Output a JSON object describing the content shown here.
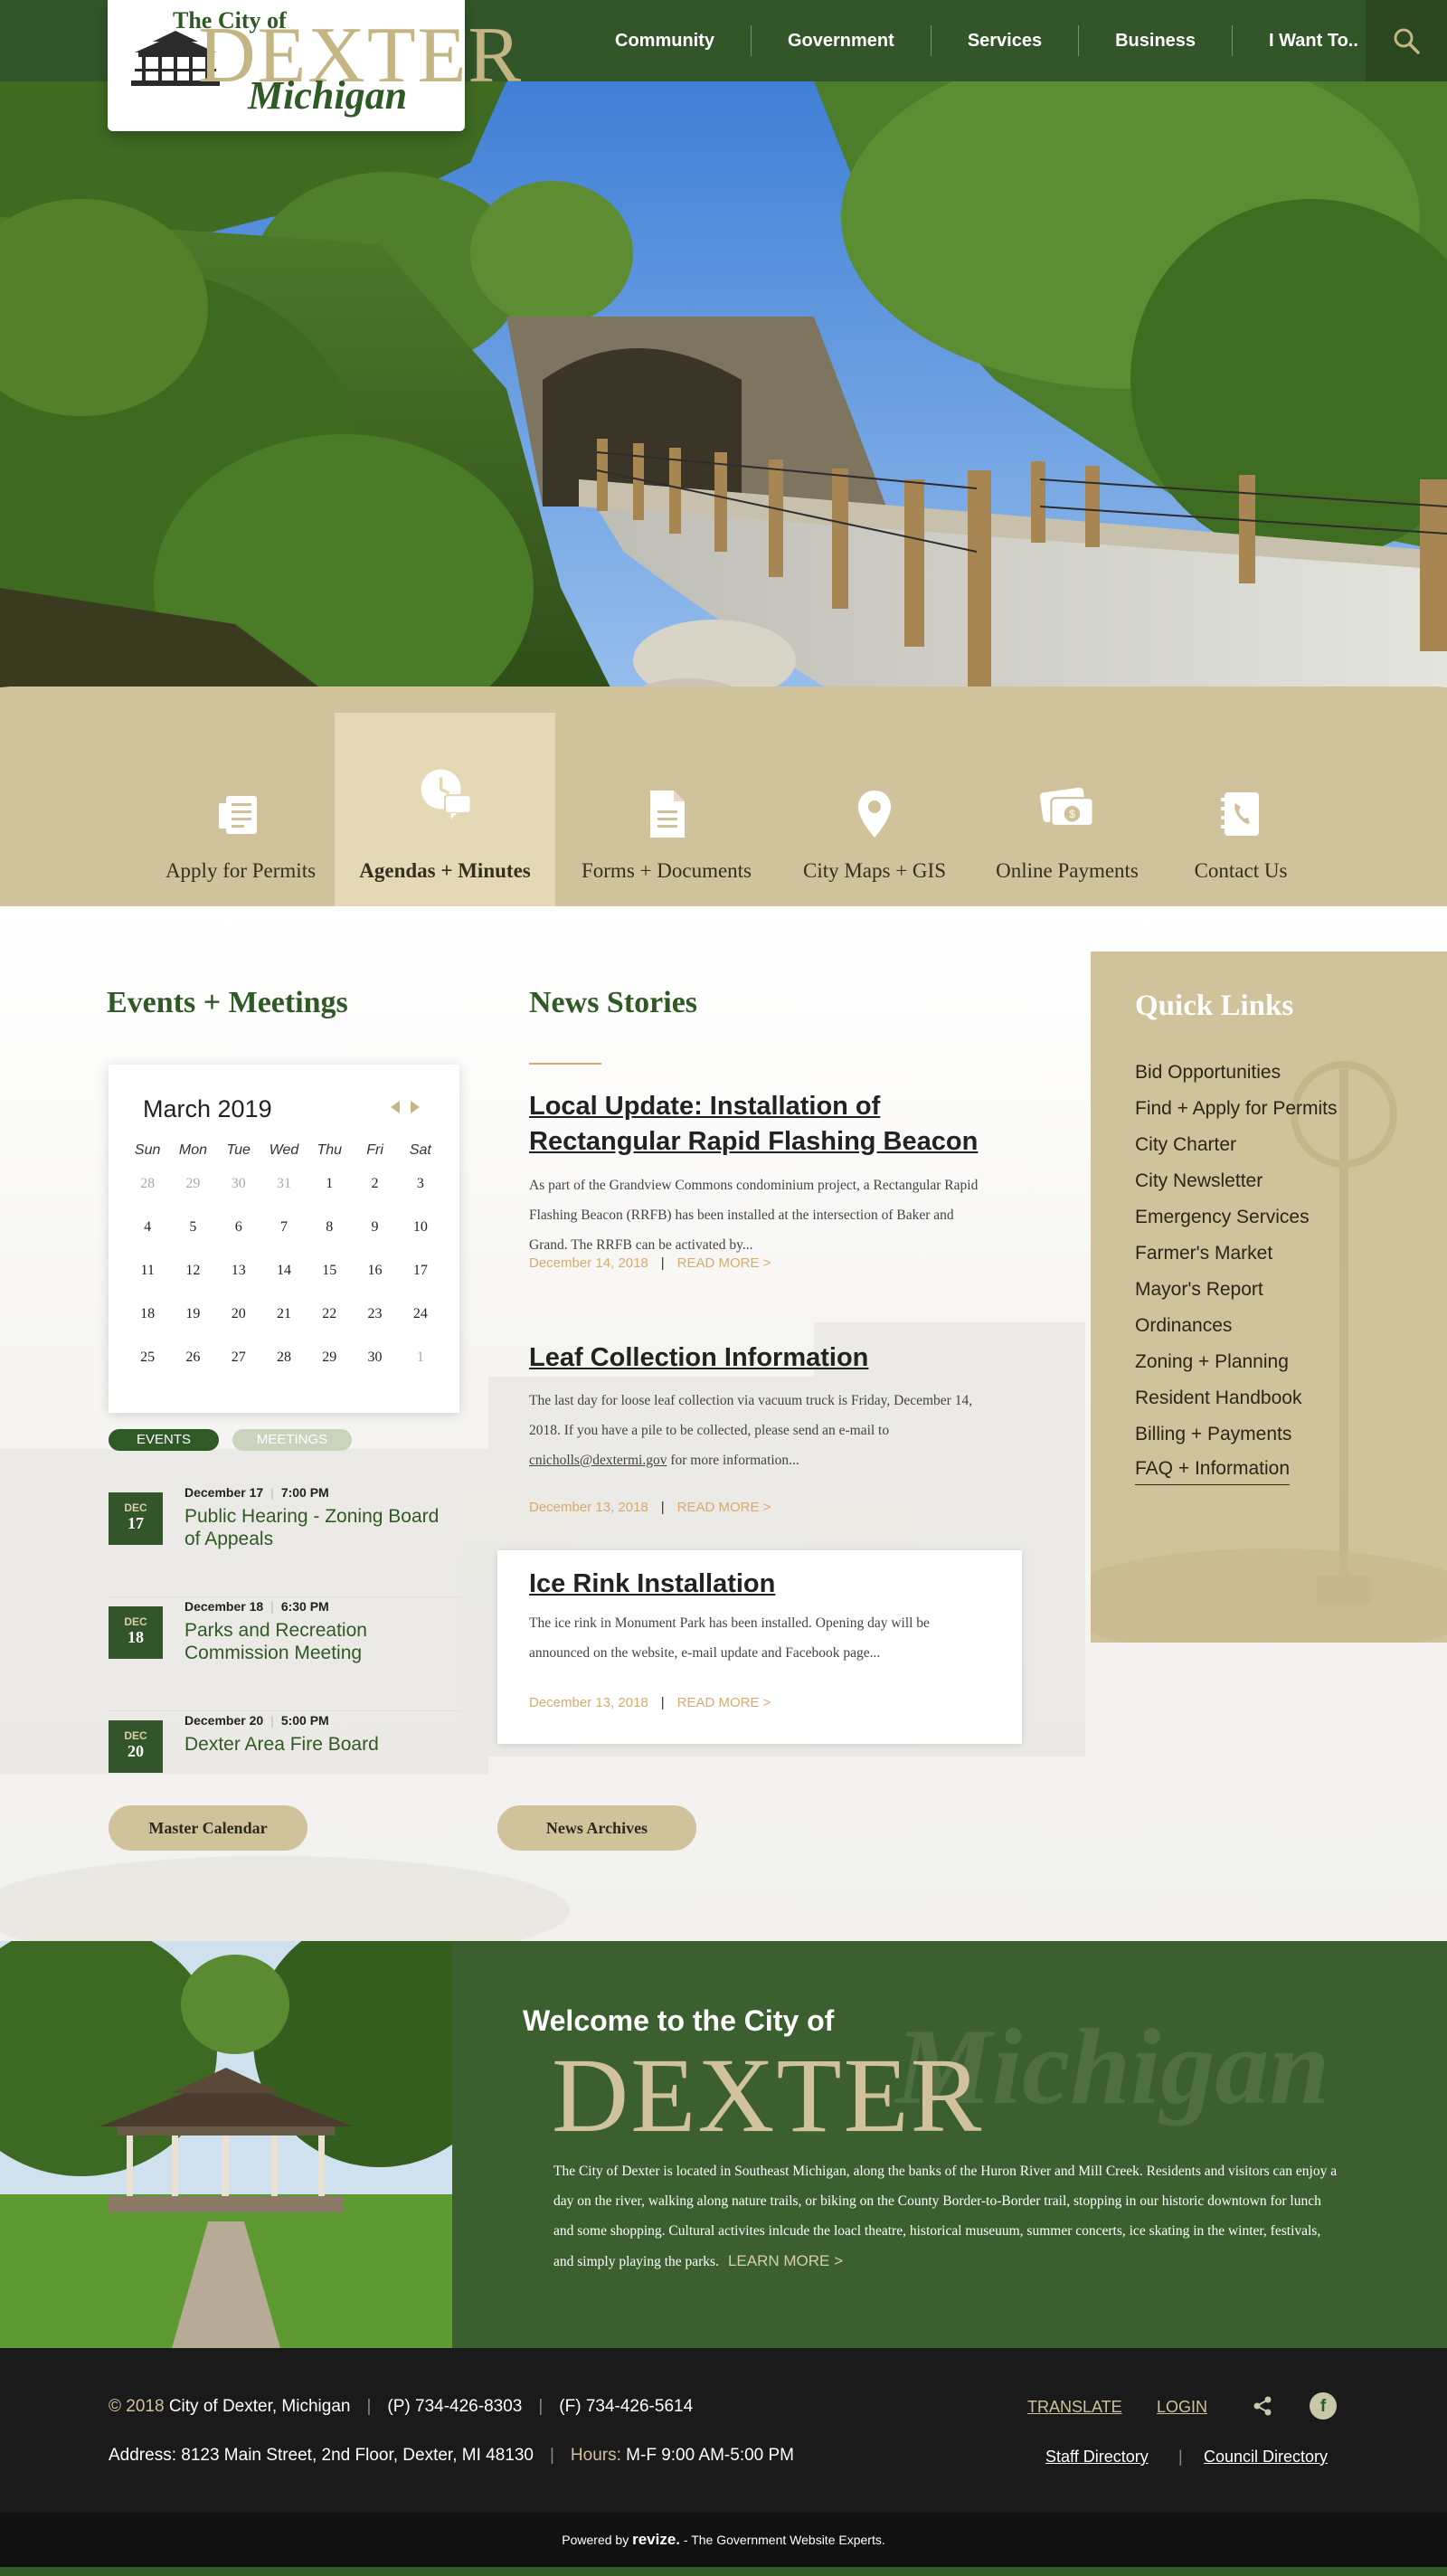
{
  "logo": {
    "line1": "The City of",
    "line2": "DEXTER",
    "line3": "Michigan"
  },
  "nav": {
    "items": [
      "Community",
      "Government",
      "Services",
      "Business",
      "I Want To.."
    ]
  },
  "quick_access": {
    "items": [
      {
        "label": "Apply for Permits",
        "icon": "permits-icon"
      },
      {
        "label": "Agendas + Minutes",
        "icon": "agendas-icon"
      },
      {
        "label": "Forms + Documents",
        "icon": "document-icon"
      },
      {
        "label": "City Maps + GIS",
        "icon": "map-pin-icon"
      },
      {
        "label": "Online Payments",
        "icon": "payment-icon"
      },
      {
        "label": "Contact Us",
        "icon": "contact-icon"
      }
    ]
  },
  "events": {
    "title": "Events + Meetings",
    "calendar": {
      "month": "March 2019",
      "weekdays": [
        "Sun",
        "Mon",
        "Tue",
        "Wed",
        "Thu",
        "Fri",
        "Sat"
      ],
      "weeks": [
        [
          "28",
          "29",
          "30",
          "31",
          "1",
          "2",
          "3"
        ],
        [
          "4",
          "5",
          "6",
          "7",
          "8",
          "9",
          "10"
        ],
        [
          "11",
          "12",
          "13",
          "14",
          "15",
          "16",
          "17"
        ],
        [
          "18",
          "19",
          "20",
          "21",
          "22",
          "23",
          "24"
        ],
        [
          "25",
          "26",
          "27",
          "28",
          "29",
          "30",
          "1"
        ]
      ]
    },
    "tabs": {
      "events": "EVENTS",
      "meetings": "MEETINGS"
    },
    "list": [
      {
        "month": "DEC",
        "day": "17",
        "date": "December 17",
        "time": "7:00 PM",
        "title": "Public Hearing - Zoning Board of Appeals"
      },
      {
        "month": "DEC",
        "day": "18",
        "date": "December 18",
        "time": "6:30 PM",
        "title": "Parks and Recreation Commission Meeting"
      },
      {
        "month": "DEC",
        "day": "20",
        "date": "December 20",
        "time": "5:00 PM",
        "title": "Dexter Area Fire Board"
      }
    ],
    "button": "Master Calendar"
  },
  "news": {
    "title": "News Stories",
    "stories": [
      {
        "title": "Local Update: Installation of Rectangular Rapid Flashing Beacon",
        "body": "As part of the Grandview Commons condominium project, a Rectangular Rapid Flashing Beacon (RRFB) has been installed at the intersection of Baker and Grand. The RRFB can be activated by...",
        "date": "December 14, 2018",
        "more": "READ MORE >"
      },
      {
        "title": "Leaf Collection Information",
        "body_before": "The last day for loose leaf collection via vacuum truck is Friday, December 14, 2018. If you have a pile to be collected, please send an e-mail to ",
        "body_email": "cnicholls@dextermi.gov",
        "body_after": " for more information...",
        "date": "December 13, 2018",
        "more": "READ MORE >"
      },
      {
        "title": "Ice Rink Installation",
        "body": "The ice rink in Monument Park has been installed. Opening day will be announced on the website, e-mail update and Facebook page...",
        "date": "December 13, 2018",
        "more": "READ MORE >"
      }
    ],
    "button": "News Archives"
  },
  "quick_links": {
    "title": "Quick Links",
    "items": [
      "Bid Opportunities",
      "Find + Apply for Permits",
      "City Charter",
      "City Newsletter",
      "Emergency Services",
      "Farmer's Market",
      "Mayor's Report",
      "Ordinances",
      "Zoning + Planning",
      "Resident Handbook",
      "Billing + Payments",
      "FAQ + Information"
    ]
  },
  "welcome": {
    "subtitle": "Welcome to the City of",
    "city": "DEXTER",
    "state": "Michigan",
    "text": "The City of Dexter is located in Southeast Michigan, along the banks of the Huron River and Mill Creek. Residents and visitors can enjoy a day on the river, walking along nature trails, or biking on the County Border-to-Border trail, stopping in our historic downtown for lunch and some shopping. Cultural activites inlcude the loacl theatre, historical museuum, summer concerts, ice skating in the winter, festivals, and simply playing the parks.",
    "more": "LEARN MORE >"
  },
  "footer": {
    "copyright_year": "© 2018",
    "name": "City of Dexter, Michigan",
    "phone": "(P) 734-426-8303",
    "fax": "(F) 734-426-5614",
    "address": "Address: 8123 Main Street, 2nd Floor, Dexter, MI 48130",
    "hours_label": "Hours:",
    "hours": "M-F  9:00 AM-5:00 PM",
    "translate": "TRANSLATE",
    "login": "LOGIN",
    "staff": "Staff Directory",
    "council": "Council Directory",
    "fb": "f"
  },
  "powered": {
    "before": "Powered by",
    "brand": "revize.",
    "after": "- The Government Website Experts."
  },
  "colors": {
    "green": "#33552a",
    "tan": "#d0c29a",
    "gold": "#d7ab6e"
  }
}
